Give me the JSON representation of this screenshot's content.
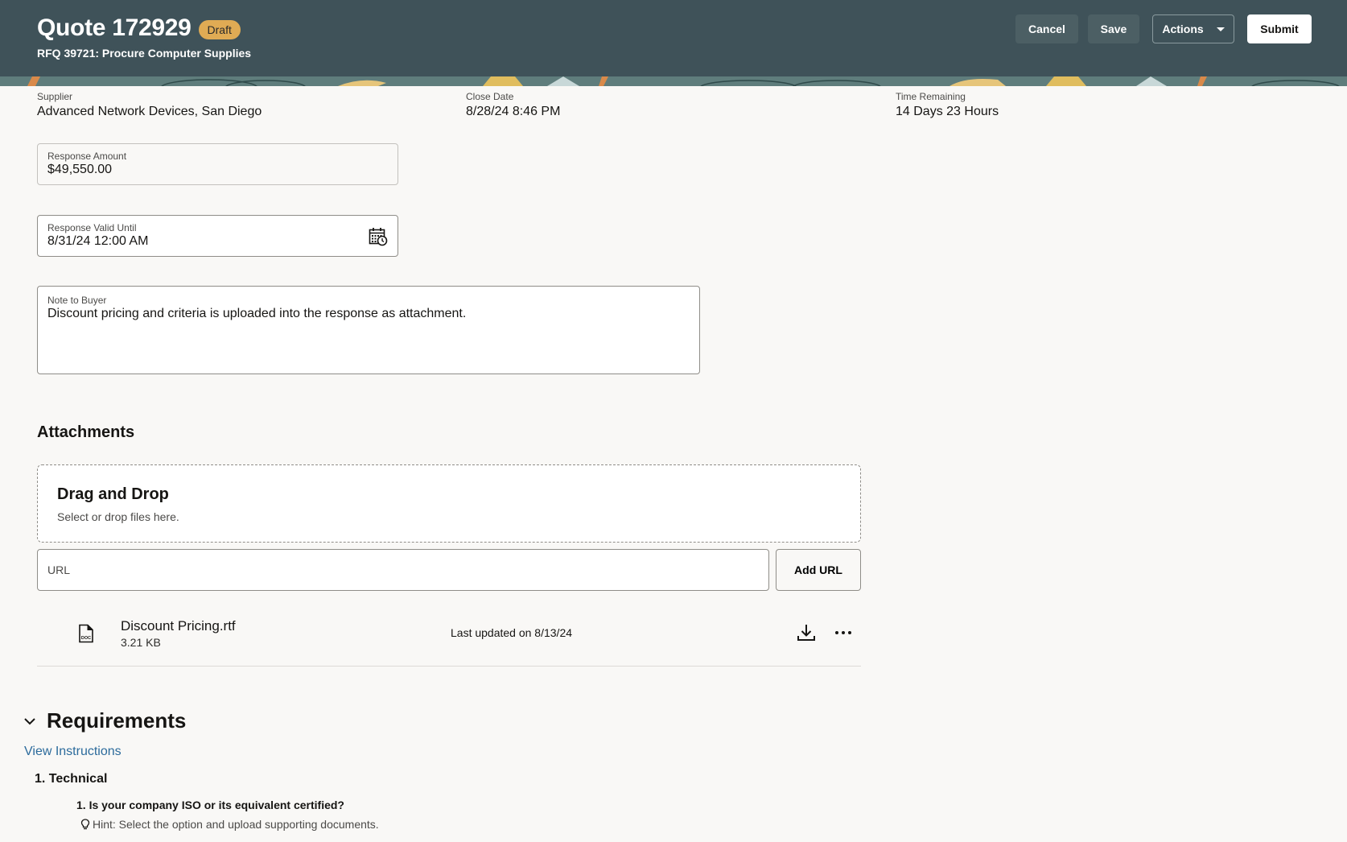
{
  "header": {
    "title": "Quote 172929",
    "status_badge": "Draft",
    "subtitle": "RFQ 39721: Procure Computer Supplies",
    "buttons": {
      "cancel": "Cancel",
      "save": "Save",
      "actions": "Actions",
      "submit": "Submit"
    }
  },
  "summary": {
    "supplier": {
      "label": "Supplier",
      "value": "Advanced Network Devices, San Diego"
    },
    "close_date": {
      "label": "Close Date",
      "value": "8/28/24 8:46 PM"
    },
    "time_remaining": {
      "label": "Time Remaining",
      "value": "14 Days 23 Hours"
    }
  },
  "form": {
    "response_amount": {
      "label": "Response Amount",
      "value": "$49,550.00"
    },
    "response_valid_until": {
      "label": "Response Valid Until",
      "value": "8/31/24 12:00 AM",
      "icon": "calendar-clock-icon"
    },
    "note_to_buyer": {
      "label": "Note to Buyer",
      "value": "Discount pricing and criteria is uploaded into the response as attachment."
    }
  },
  "attachments": {
    "title": "Attachments",
    "dropzone": {
      "title": "Drag and Drop",
      "subtitle": "Select or drop files here."
    },
    "url_placeholder": "URL",
    "add_url_label": "Add URL",
    "files": [
      {
        "name": "Discount Pricing.rtf",
        "size": "3.21 KB",
        "updated": "Last updated on 8/13/24",
        "icon": "doc-file-icon"
      }
    ]
  },
  "requirements": {
    "title": "Requirements",
    "view_instructions": "View Instructions",
    "sections": [
      {
        "title": "1. Technical",
        "questions": [
          {
            "text": "1.  Is your company ISO or its equivalent certified?",
            "hint": "Hint: Select the option and upload supporting documents."
          }
        ]
      }
    ]
  },
  "colors": {
    "header_bg": "#3f5259",
    "badge_bg": "#e0ab54",
    "link": "#2c6b9c",
    "page_bg": "#f9f8f6"
  }
}
